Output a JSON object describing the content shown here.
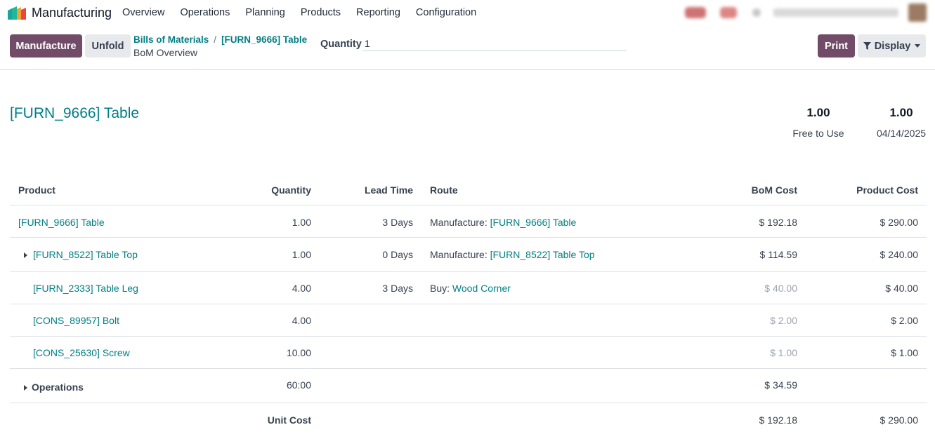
{
  "app": {
    "name": "Manufacturing"
  },
  "menu": [
    "Overview",
    "Operations",
    "Planning",
    "Products",
    "Reporting",
    "Configuration"
  ],
  "toolbar": {
    "manufacture_label": "Manufacture",
    "unfold_label": "Unfold",
    "print_label": "Print",
    "display_label": "Display"
  },
  "breadcrumb": {
    "parent": "Bills of Materials",
    "separator": "/",
    "current": "[FURN_9666] Table",
    "subtitle": "BoM Overview"
  },
  "quantity": {
    "label": "Quantity",
    "value": "1"
  },
  "header": {
    "title": "[FURN_9666] Table",
    "free_to_use_value": "1.00",
    "free_to_use_label": "Free to Use",
    "date_value": "1.00",
    "date_label": "04/14/2025"
  },
  "table": {
    "columns": {
      "product": "Product",
      "quantity": "Quantity",
      "lead_time": "Lead Time",
      "route": "Route",
      "bom_cost": "BoM Cost",
      "product_cost": "Product Cost"
    },
    "rows": [
      {
        "product": "[FURN_9666] Table",
        "quantity": "1.00",
        "lead_time": "3 Days",
        "route_prefix": "Manufacture:",
        "route_link": "[FURN_9666] Table",
        "bom_cost": "$ 192.18",
        "product_cost": "$ 290.00"
      },
      {
        "product": "[FURN_8522] Table Top",
        "quantity": "1.00",
        "lead_time": "0 Days",
        "route_prefix": "Manufacture:",
        "route_link": "[FURN_8522] Table Top",
        "bom_cost": "$ 114.59",
        "product_cost": "$ 240.00"
      },
      {
        "product": "[FURN_2333] Table Leg",
        "quantity": "4.00",
        "lead_time": "3 Days",
        "route_prefix": "Buy:",
        "route_link": "Wood Corner",
        "bom_cost": "$ 40.00",
        "product_cost": "$ 40.00"
      },
      {
        "product": "[CONS_89957] Bolt",
        "quantity": "4.00",
        "lead_time": "",
        "route_prefix": "",
        "route_link": "",
        "bom_cost": "$ 2.00",
        "product_cost": "$ 2.00"
      },
      {
        "product": "[CONS_25630] Screw",
        "quantity": "10.00",
        "lead_time": "",
        "route_prefix": "",
        "route_link": "",
        "bom_cost": "$ 1.00",
        "product_cost": "$ 1.00"
      }
    ],
    "operations": {
      "label": "Operations",
      "quantity": "60:00",
      "bom_cost": "$ 34.59"
    },
    "unit_cost": {
      "label": "Unit Cost",
      "bom_cost": "$ 192.18",
      "product_cost": "$ 290.00"
    }
  },
  "colors": {
    "primary": "#714b67",
    "link": "#017e84",
    "secondary_button": "#e7e9ed"
  }
}
